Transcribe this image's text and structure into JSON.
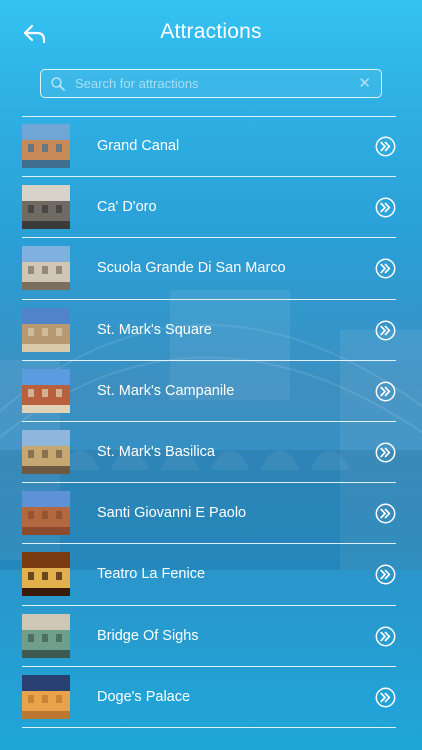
{
  "header": {
    "title": "Attractions",
    "back_icon": "back-arrow-icon"
  },
  "search": {
    "placeholder": "Search for attractions",
    "value": ""
  },
  "attractions": [
    {
      "label": "Grand Canal",
      "thumb_colors": [
        "#6fa6d6",
        "#c98a5a",
        "#3f6f8f"
      ]
    },
    {
      "label": "Ca' D'oro",
      "thumb_colors": [
        "#d8d3c8",
        "#6f6a62",
        "#3a3a3a"
      ]
    },
    {
      "label": "Scuola Grande Di San Marco",
      "thumb_colors": [
        "#7fb0e0",
        "#cfc6b4",
        "#7a6e5c"
      ]
    },
    {
      "label": "St. Mark's Square",
      "thumb_colors": [
        "#4f85c8",
        "#b89a72",
        "#d9c9a9"
      ]
    },
    {
      "label": "St. Mark's Campanile",
      "thumb_colors": [
        "#5b9be0",
        "#b9603f",
        "#e0d2b6"
      ]
    },
    {
      "label": "St. Mark's Basilica",
      "thumb_colors": [
        "#8fb6dc",
        "#c7a873",
        "#6e5a40"
      ]
    },
    {
      "label": "Santi Giovanni E Paolo",
      "thumb_colors": [
        "#5d93d6",
        "#b3683f",
        "#8c4b2c"
      ]
    },
    {
      "label": "Teatro La Fenice",
      "thumb_colors": [
        "#7a3a10",
        "#e2b04c",
        "#3a1a08"
      ]
    },
    {
      "label": "Bridge Of Sighs",
      "thumb_colors": [
        "#cfc7b6",
        "#6f9f8a",
        "#3f5a52"
      ]
    },
    {
      "label": "Doge's Palace",
      "thumb_colors": [
        "#2a3f72",
        "#e8a24a",
        "#b9772f"
      ]
    }
  ],
  "icons": {
    "search": "search-icon",
    "clear": "clear-icon",
    "row_action": "chevron-double-right-icon"
  }
}
